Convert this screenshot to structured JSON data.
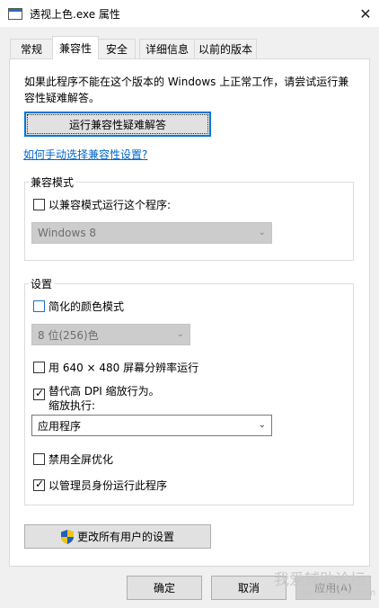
{
  "window": {
    "title": "透视上色.exe 属性",
    "close_glyph": "✕"
  },
  "tabs": [
    {
      "label": "常规"
    },
    {
      "label": "兼容性"
    },
    {
      "label": "安全"
    },
    {
      "label": "详细信息"
    },
    {
      "label": "以前的版本"
    }
  ],
  "active_tab": "兼容性",
  "compat": {
    "intro": "如果此程序不能在这个版本的 Windows 上正常工作，请尝试运行兼容性疑难解答。",
    "troubleshoot_button": "运行兼容性疑难解答",
    "manual_link": "如何手动选择兼容性设置?"
  },
  "compat_mode": {
    "group_title": "兼容模式",
    "checkbox_label": "以兼容模式运行这个程序:",
    "checked": false,
    "os_select_value": "Windows 8",
    "os_select_disabled": true
  },
  "settings": {
    "group_title": "设置",
    "reduced_color": {
      "label": "简化的颜色模式",
      "checked": false
    },
    "color_select_value": "8 位(256)色",
    "color_select_disabled": true,
    "res_640": {
      "label": "用 640 × 480 屏幕分辨率运行",
      "checked": false
    },
    "dpi_override": {
      "label_line1": "替代高 DPI 缩放行为。",
      "label_line2": "缩放执行:",
      "checked": true
    },
    "dpi_select_value": "应用程序",
    "fullscreen_opt": {
      "label": "禁用全屏优化",
      "checked": false
    },
    "run_as_admin": {
      "label": "以管理员身份运行此程序",
      "checked": true
    }
  },
  "change_all_button": "更改所有用户的设置",
  "footer": {
    "ok": "确定",
    "cancel": "取消",
    "apply": "应用(A)",
    "apply_disabled": true
  },
  "watermark": {
    "line1": "我爱辅助论坛",
    "line2": "www.52fzba.com"
  },
  "icons": {
    "app": "exe-window-icon",
    "shield": "uac-shield-icon",
    "chevron": "chevron-down-icon",
    "check": "checkmark-icon"
  },
  "colors": {
    "link": "#0066cc",
    "focus_border": "#0078d7",
    "disabled_select": "#cccccc"
  }
}
